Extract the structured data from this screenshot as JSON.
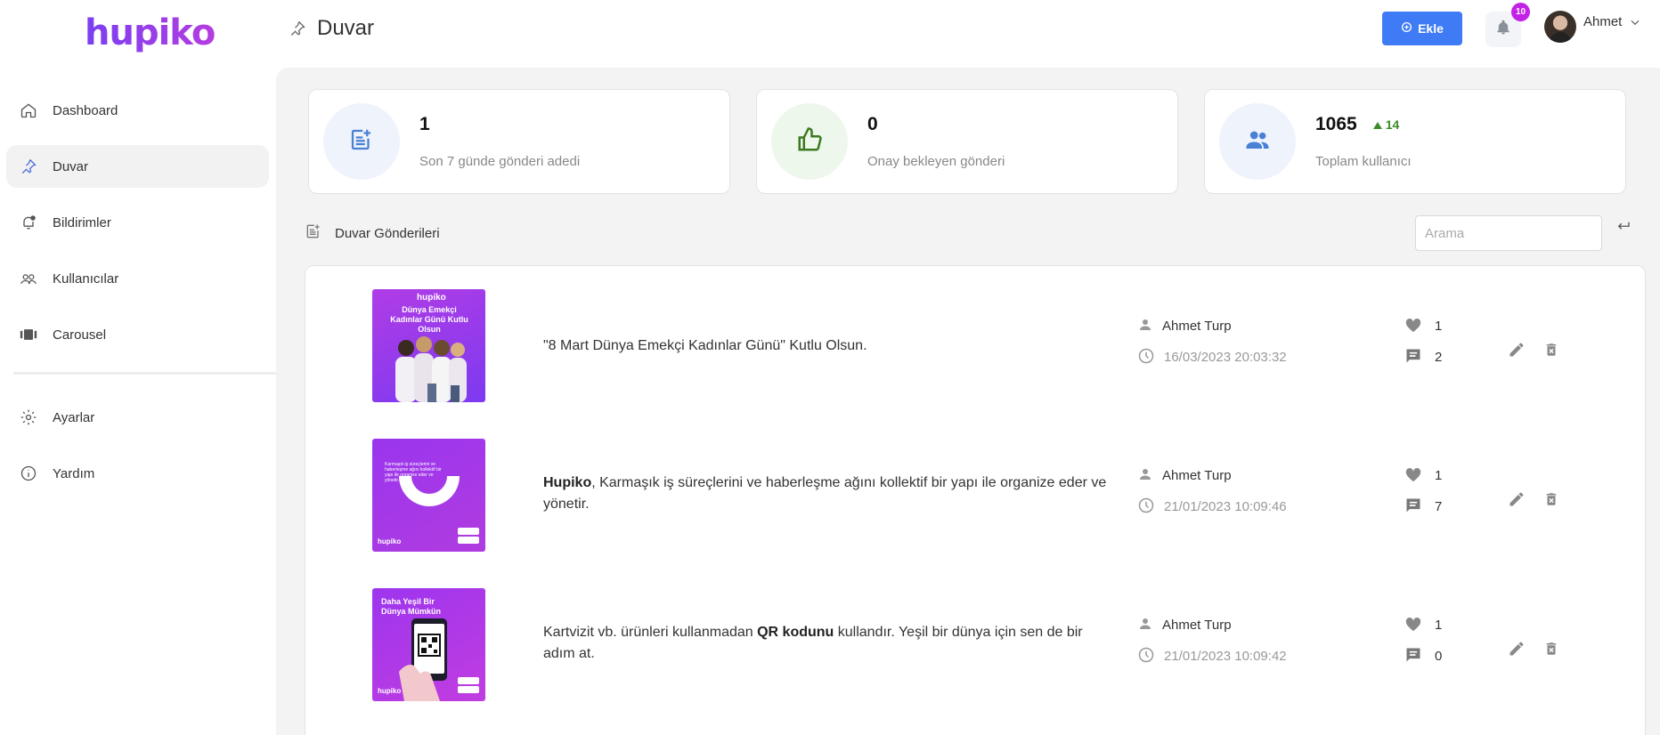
{
  "app": {
    "logo": "hupiko"
  },
  "sidebar": {
    "items": [
      {
        "label": "Dashboard",
        "icon": "home-icon"
      },
      {
        "label": "Duvar",
        "icon": "pin-icon",
        "active": true
      },
      {
        "label": "Bildirimler",
        "icon": "bell-alert-icon"
      },
      {
        "label": "Kullanıcılar",
        "icon": "users-icon"
      },
      {
        "label": "Carousel",
        "icon": "carousel-icon"
      }
    ],
    "bottom_items": [
      {
        "label": "Ayarlar",
        "icon": "gear-icon"
      },
      {
        "label": "Yardım",
        "icon": "info-icon"
      }
    ]
  },
  "header": {
    "title": "Duvar",
    "add_button": "Ekle",
    "notification_count": "10",
    "user_name": "Ahmet"
  },
  "stats": [
    {
      "value": "1",
      "label": "Son 7 günde gönderi adedi",
      "icon": "post-add-icon",
      "color": "#4a7fd6",
      "bg": "#eef3fc"
    },
    {
      "value": "0",
      "label": "Onay bekleyen gönderi",
      "icon": "thumb-up-icon",
      "color": "#3c7a1f",
      "bg": "#eef7ec"
    },
    {
      "value": "1065",
      "delta": "14",
      "label": "Toplam kullanıcı",
      "icon": "group-icon",
      "color": "#4a7fd6",
      "bg": "#eef3fc"
    }
  ],
  "section": {
    "title": "Duvar Gönderileri",
    "search_placeholder": "Arama"
  },
  "posts": [
    {
      "thumb_logo": "hupiko",
      "thumb_text": "Dünya Emekçi Kadınlar Günü Kutlu Olsun",
      "text_plain": "\"8 Mart Dünya Emekçi Kadınlar Günü\" Kutlu Olsun.",
      "author": "Ahmet Turp",
      "date": "16/03/2023 20:03:32",
      "likes": "1",
      "comments": "2"
    },
    {
      "thumb_logo": "hupiko",
      "thumb_text": "Karmaşık iş süreçlerini ve haberleşme ağını kollektif bir yapı ile organize eder ve yönetir.",
      "text_bold1": "Hupiko",
      "text_rest1": ", Karmaşık iş süreçlerini ve haberleşme ağını kollektif bir yapı ile organize eder ve yönetir.",
      "author": "Ahmet Turp",
      "date": "21/01/2023 10:09:46",
      "likes": "1",
      "comments": "7"
    },
    {
      "thumb_logo": "hupiko",
      "thumb_text": "Daha Yeşil Bir Dünya Mümkün",
      "text_pre": "Kartvizit vb. ürünleri kullanmadan ",
      "text_bold": "QR kodunu",
      "text_post": " kullandır. Yeşil bir dünya için sen de bir adım at.",
      "author": "Ahmet Turp",
      "date": "21/01/2023 10:09:42",
      "likes": "1",
      "comments": "0"
    }
  ],
  "colors": {
    "accent": "#3f7bf5",
    "badge": "#c320e8",
    "brand": "#8a3cf0"
  }
}
